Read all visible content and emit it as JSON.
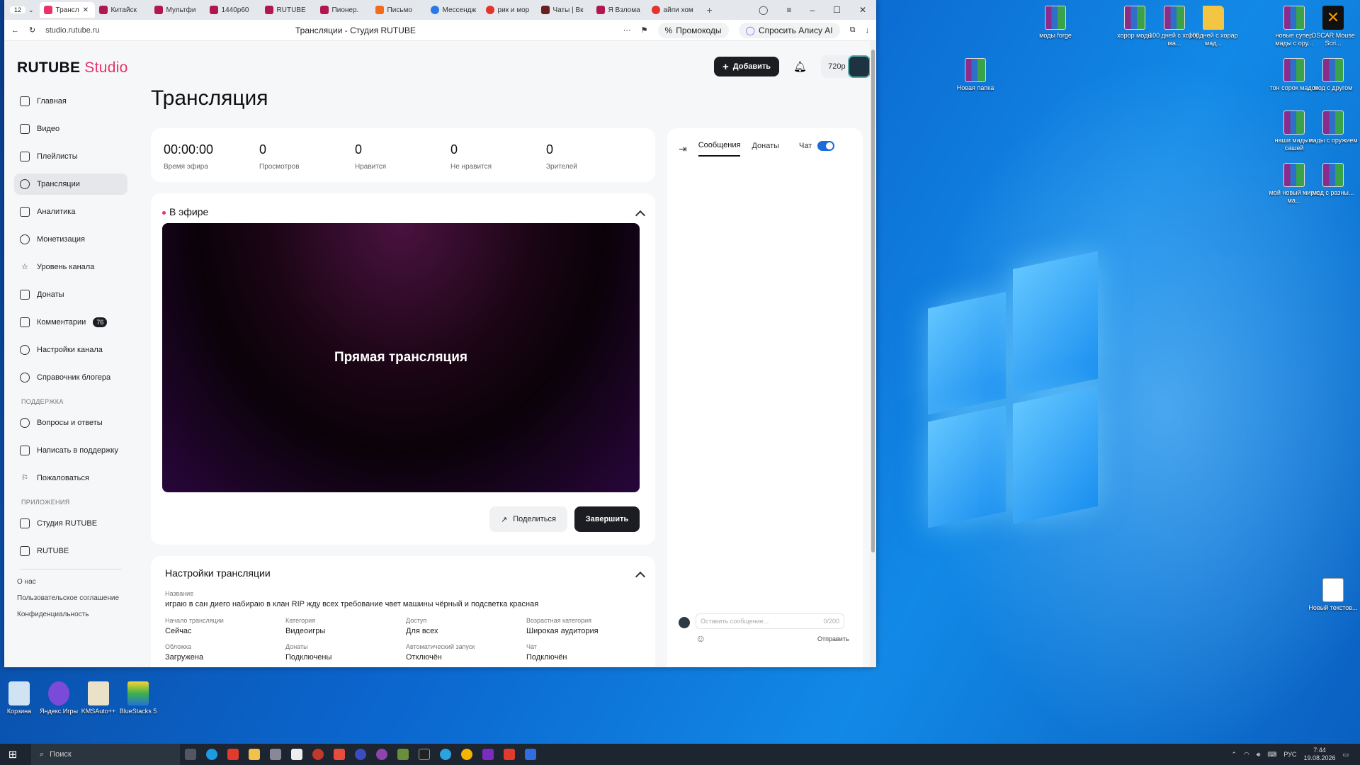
{
  "browser": {
    "tab_count": "12",
    "tabs": [
      "Трансл",
      "Китайск",
      "Мультфи",
      "1440p60",
      "RUTUBE",
      "Пионер.",
      "Письмо",
      "Мессендж",
      "рик и мор",
      "Чаты | Вк",
      "Я Взлома",
      "айпи хом"
    ],
    "url": "studio.rutube.ru",
    "page_title": "Трансляции - Студия RUTUBE",
    "promo_label": "Промокоды",
    "alice_label": "Спросить Алису AI"
  },
  "app": {
    "logo": "RUTUBE",
    "logo_suffix": "Studio",
    "add_button": "Добавить",
    "quality": "720p"
  },
  "sidebar": {
    "items": [
      {
        "label": "Главная",
        "icon": "home-icon"
      },
      {
        "label": "Видео",
        "icon": "video-icon"
      },
      {
        "label": "Плейлисты",
        "icon": "playlist-icon"
      },
      {
        "label": "Трансляции",
        "icon": "broadcast-icon"
      },
      {
        "label": "Аналитика",
        "icon": "analytics-icon"
      },
      {
        "label": "Монетизация",
        "icon": "monetization-icon"
      },
      {
        "label": "Уровень канала",
        "icon": "star-icon"
      },
      {
        "label": "Донаты",
        "icon": "donate-icon"
      },
      {
        "label": "Комментарии",
        "icon": "comment-icon",
        "badge": "76"
      },
      {
        "label": "Настройки канала",
        "icon": "gear-icon"
      },
      {
        "label": "Справочник блогера",
        "icon": "info-icon"
      }
    ],
    "support_title": "ПОДДЕРЖКА",
    "support_items": [
      "Вопросы и ответы",
      "Написать в поддержку",
      "Пожаловаться"
    ],
    "apps_title": "ПРИЛОЖЕНИЯ",
    "app_items": [
      "Студия RUTUBE",
      "RUTUBE"
    ],
    "footer": [
      "О нас",
      "Пользовательское соглашение",
      "Конфиденциальность"
    ]
  },
  "main": {
    "title": "Трансляция",
    "stats": [
      {
        "value": "00:00:00",
        "label": "Время эфира"
      },
      {
        "value": "0",
        "label": "Просмотров"
      },
      {
        "value": "0",
        "label": "Нравится"
      },
      {
        "value": "0",
        "label": "Не нравится"
      },
      {
        "value": "0",
        "label": "Зрителей"
      }
    ],
    "live_title": "В эфире",
    "player_text": "Прямая трансляция",
    "share_button": "Поделиться",
    "end_button": "Завершить",
    "settings_title": "Настройки трансляции",
    "name_label": "Название",
    "name_value": "играю в сан диего набираю в клан RIP жду всех требование чвет машины чёрный и подсветка красная",
    "fields": [
      {
        "label": "Начало трансляции",
        "value": "Сейчас"
      },
      {
        "label": "Категория",
        "value": "Видеоигры"
      },
      {
        "label": "Доступ",
        "value": "Для всех"
      },
      {
        "label": "Возрастная категория",
        "value": "Широкая аудитория"
      },
      {
        "label": "Обложка",
        "value": "Загружена"
      },
      {
        "label": "Донаты",
        "value": "Подключены"
      },
      {
        "label": "Автоматический запуск",
        "value": "Отключён"
      },
      {
        "label": "Чат",
        "value": "Подключён"
      }
    ]
  },
  "chat": {
    "tab_messages": "Сообщения",
    "tab_donates": "Донаты",
    "toggle_label": "Чат",
    "toggle_on": true,
    "placeholder": "Оставить сообщение...",
    "counter": "0/200",
    "send": "Отправить"
  },
  "desktop": {
    "icons": [
      "моды forge",
      "хорор моды",
      "100 дней с хорор ма...",
      "100дней с хорар мад...",
      "новые супер мады с ору...",
      "OSCAR Mouse Scri...",
      "Новая папка",
      "тон сорок мадов",
      "мод с другом",
      "наши мады с сашей",
      "мады с оружием",
      "мой новый мир с ма...",
      "мод с разны...",
      "Новый текстов..."
    ],
    "bottom_icons": [
      "Корзина",
      "Яндекс.Игры",
      "KMSAuto++",
      "BlueStacks 5"
    ]
  },
  "taskbar": {
    "search_placeholder": "Поиск",
    "lang": "РУС",
    "time": "7:44",
    "date": "19.08.2026"
  }
}
